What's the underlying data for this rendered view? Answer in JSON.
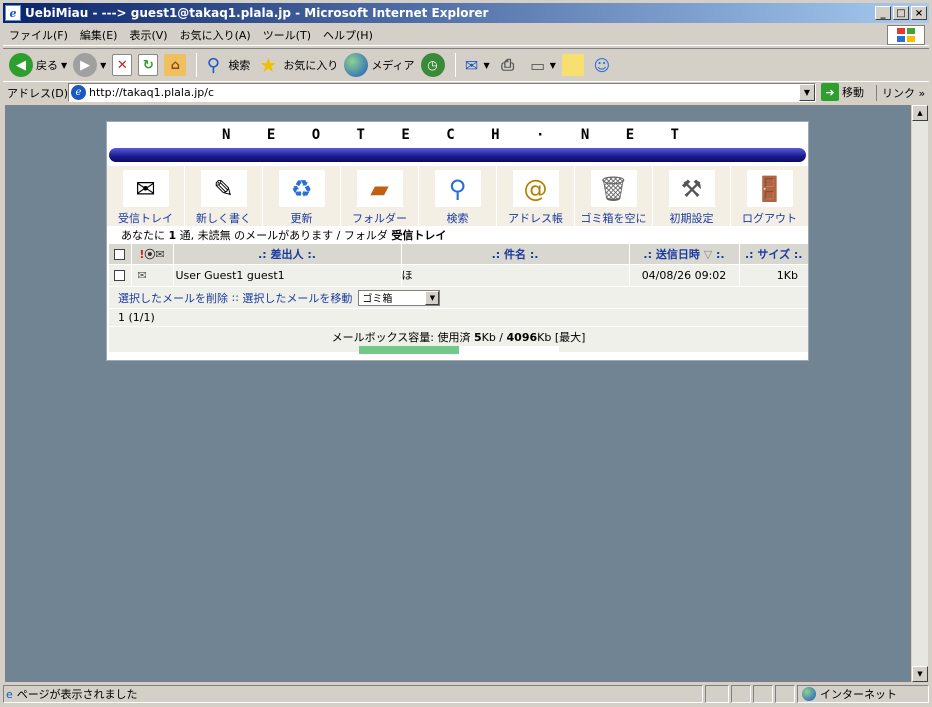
{
  "window": {
    "title": "UebiMiau - ---> guest1@takaq1.plala.jp - Microsoft Internet Explorer"
  },
  "menu": [
    "ファイル(F)",
    "編集(E)",
    "表示(V)",
    "お気に入り(A)",
    "ツール(T)",
    "ヘルプ(H)"
  ],
  "toolbar": {
    "back": "戻る",
    "search": "検索",
    "favorites": "お気に入り",
    "media": "メディア"
  },
  "address": {
    "label": "アドレス(D)",
    "url": "http://takaq1.plala.jp/c",
    "go": "移動",
    "links": "リンク"
  },
  "app": {
    "logo": "N E O T E C H · N E T",
    "nav": [
      {
        "label": "受信トレイ",
        "icon": "inbox-icon"
      },
      {
        "label": "新しく書く",
        "icon": "compose-icon"
      },
      {
        "label": "更新",
        "icon": "refresh-icon"
      },
      {
        "label": "フォルダー",
        "icon": "folder-icon"
      },
      {
        "label": "検索",
        "icon": "search-icon"
      },
      {
        "label": "アドレス帳",
        "icon": "addressbook-icon"
      },
      {
        "label": "ゴミ箱を空に",
        "icon": "trash-icon"
      },
      {
        "label": "初期設定",
        "icon": "settings-icon"
      },
      {
        "label": "ログアウト",
        "icon": "logout-icon"
      }
    ],
    "info": {
      "pre": "あなたに",
      "count": "1",
      "mid": "通, 未読無 のメールがあります / フォルダ",
      "folder": "受信トレイ"
    },
    "columns": {
      "from": ".: 差出人 :.",
      "subject": ".: 件名 :.",
      "date": ".: 送信日時",
      "date_sort": "▽",
      "date_end": ":.",
      "size": ".: サイズ :."
    },
    "messages": [
      {
        "from": "User Guest1 guest1",
        "subject": "ほ",
        "date": "04/08/26 09:02",
        "size": "1Kb"
      }
    ],
    "actions": {
      "delete": "選択したメールを削除",
      "sep": "::",
      "move": "選択したメールを移動",
      "target": "ゴミ箱"
    },
    "pager": "1 (1/1)",
    "quota": {
      "label": "メールボックス容量: 使用済",
      "used": "5",
      "unit1": "Kb /",
      "total": "4096",
      "unit2": "Kb [最大]",
      "fill_ratio": 0.5
    }
  },
  "status": {
    "text": "ページが表示されました",
    "zone": "インターネット"
  }
}
